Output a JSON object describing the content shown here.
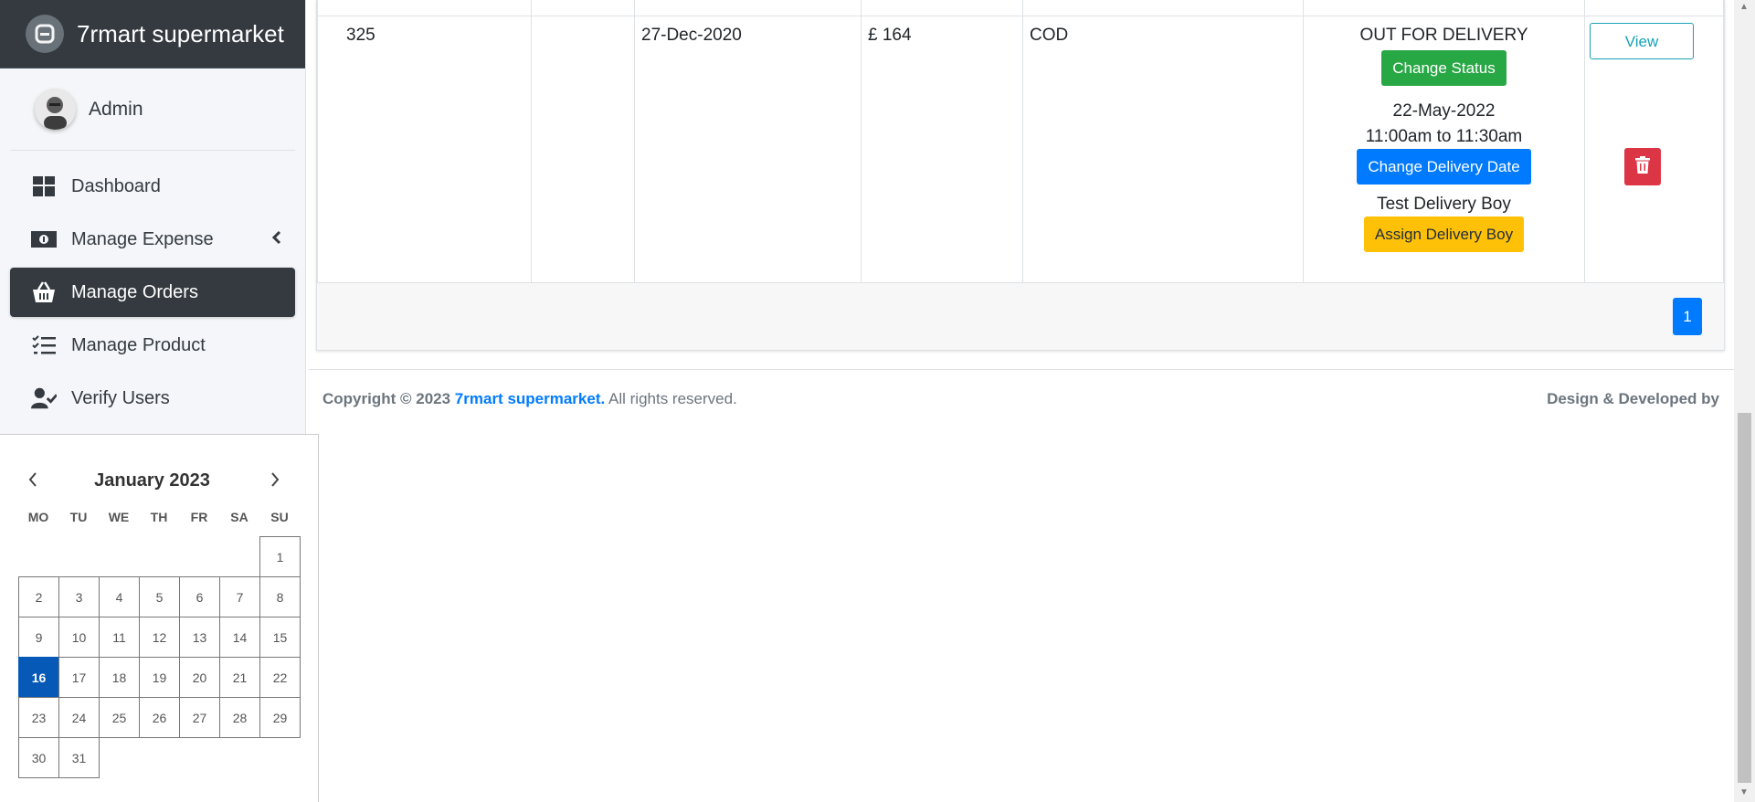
{
  "app": {
    "brand": "7rmart supermarket"
  },
  "user": {
    "name": "Admin"
  },
  "sidebar": {
    "items": [
      {
        "label": "Dashboard",
        "icon": "dashboard-icon",
        "active": false
      },
      {
        "label": "Manage Expense",
        "icon": "money-icon",
        "active": false
      },
      {
        "label": "Manage Orders",
        "icon": "basket-icon",
        "active": true
      },
      {
        "label": "Manage Product",
        "icon": "tasks-icon",
        "active": false
      },
      {
        "label": "Verify Users",
        "icon": "user-check-icon",
        "active": false
      }
    ]
  },
  "calendar": {
    "title": "January 2023",
    "weekdays": [
      "MO",
      "TU",
      "WE",
      "TH",
      "FR",
      "SA",
      "SU"
    ],
    "selected_day": 16
  },
  "order": {
    "id": "325",
    "date": "27-Dec-2020",
    "amount": "£ 164",
    "payment": "COD",
    "status": "OUT FOR DELIVERY",
    "change_status_label": "Change Status",
    "delivery_date": "22-May-2022",
    "delivery_time": "11:00am to 11:30am",
    "change_delivery_date_label": "Change Delivery Date",
    "delivery_boy": "Test Delivery Boy",
    "assign_delivery_boy_label": "Assign Delivery Boy",
    "view_label": "View"
  },
  "pagination": {
    "current": "1"
  },
  "footer": {
    "copyright_prefix": "Copyright © 2023",
    "brand": "7rmart supermarket.",
    "rights": "All rights reserved.",
    "right_text": "Design & Developed by"
  },
  "colors": {
    "primary": "#007bff",
    "success": "#28a745",
    "warning": "#ffc107",
    "danger": "#dc3545",
    "dark": "#343a40",
    "selected_day": "#0759b8"
  }
}
